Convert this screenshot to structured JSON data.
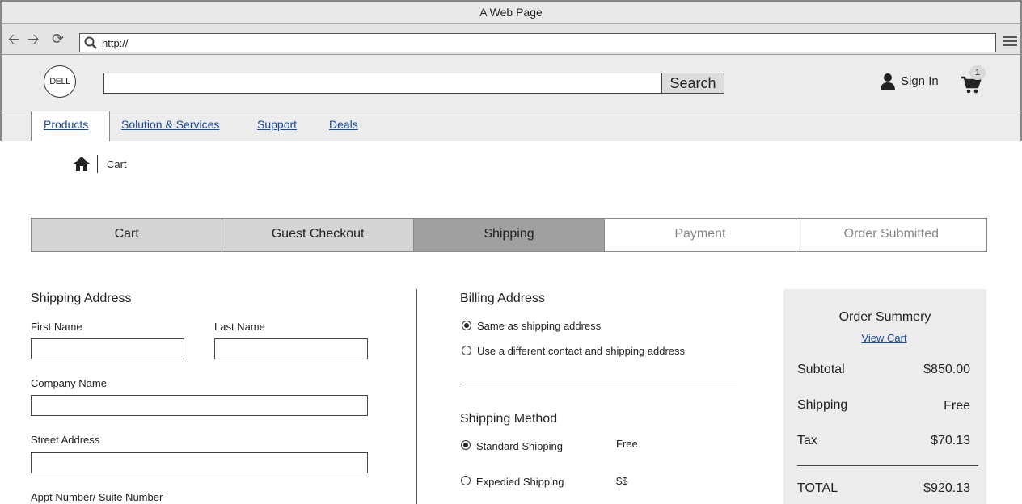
{
  "window": {
    "title": "A Web Page",
    "url": "http://"
  },
  "header": {
    "logo_text": "DELL",
    "search_button": "Search",
    "sign_in": "Sign In",
    "cart_count": "1"
  },
  "nav": {
    "items": [
      {
        "label": "Products",
        "active": true
      },
      {
        "label": "Solution & Services"
      },
      {
        "label": "Support"
      },
      {
        "label": "Deals"
      }
    ]
  },
  "breadcrumb": {
    "current": "Cart"
  },
  "steps": [
    {
      "label": "Cart",
      "state": "done"
    },
    {
      "label": "Guest Checkout",
      "state": "done"
    },
    {
      "label": "Shipping",
      "state": "current"
    },
    {
      "label": "Payment",
      "state": "todo"
    },
    {
      "label": "Order Submitted",
      "state": "todo"
    }
  ],
  "shipping_address": {
    "title": "Shipping Address",
    "first_name_label": "First Name",
    "last_name_label": "Last Name",
    "company_label": "Company Name",
    "street_label": "Street Address",
    "appt_label": "Appt Number/ Suite Number"
  },
  "billing": {
    "title": "Billing Address",
    "options": [
      {
        "label": "Same as shipping address",
        "selected": true
      },
      {
        "label": "Use a different contact and shipping address",
        "selected": false
      }
    ]
  },
  "shipping_method": {
    "title": "Shipping Method",
    "options": [
      {
        "label": "Standard Shipping",
        "price": "Free",
        "selected": true
      },
      {
        "label": "Expedied Shipping",
        "price": "$$",
        "selected": false
      }
    ]
  },
  "summary": {
    "title": "Order Summery",
    "view_cart": "View Cart",
    "rows": [
      {
        "label": "Subtotal",
        "value": "$850.00"
      },
      {
        "label": "Shipping",
        "value": "Free"
      },
      {
        "label": "Tax",
        "value": "$70.13"
      }
    ],
    "total_label": "TOTAL",
    "total_value": "$920.13"
  },
  "colors": {
    "link": "#1a4a99",
    "step_done": "#d4d4d4",
    "step_current": "#a0a0a0",
    "panel": "#ececec"
  }
}
